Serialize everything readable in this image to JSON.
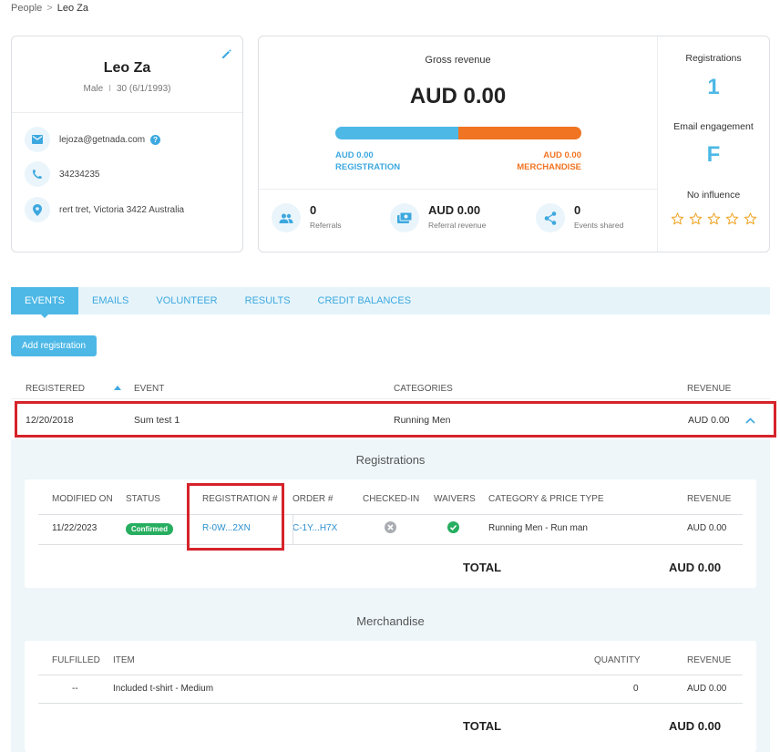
{
  "breadcrumb": {
    "parent": "People",
    "separator": ">",
    "current": "Leo Za"
  },
  "profile": {
    "name": "Leo Za",
    "gender": "Male",
    "divider": "I",
    "age_dob": "30 (6/1/1993)",
    "email": "lejoza@getnada.com",
    "phone": "34234235",
    "address": "rert tret, Victoria 3422 Australia"
  },
  "revenue": {
    "gross_label": "Gross revenue",
    "gross_value": "AUD 0.00",
    "registration_share": 0.5,
    "registration_value": "AUD 0.00",
    "registration_label": "REGISTRATION",
    "merchandise_value": "AUD 0.00",
    "merchandise_label": "MERCHANDISE",
    "colors": {
      "registration": "#4db8e6",
      "merchandise": "#f07422"
    }
  },
  "stats": {
    "referrals_value": "0",
    "referrals_label": "Referrals",
    "referral_revenue_value": "AUD 0.00",
    "referral_revenue_label": "Referral revenue",
    "events_shared_value": "0",
    "events_shared_label": "Events shared"
  },
  "side": {
    "registrations_label": "Registrations",
    "registrations_value": "1",
    "engagement_label": "Email engagement",
    "engagement_value": "F",
    "influence_label": "No influence",
    "influence_stars": 0,
    "influence_max": 5
  },
  "tabs": [
    "EVENTS",
    "EMAILS",
    "VOLUNTEER",
    "RESULTS",
    "CREDIT BALANCES"
  ],
  "add_registration": "Add registration",
  "events_table": {
    "headers": {
      "registered": "REGISTERED",
      "event": "EVENT",
      "categories": "CATEGORIES",
      "revenue": "REVENUE"
    },
    "row": {
      "registered": "12/20/2018",
      "event": "Sum test 1",
      "categories": "Running Men",
      "revenue": "AUD 0.00"
    }
  },
  "registrations": {
    "title": "Registrations",
    "headers": {
      "modified_on": "MODIFIED ON",
      "status": "STATUS",
      "registration_no": "REGISTRATION #",
      "order_no": "ORDER #",
      "checked_in": "CHECKED-IN",
      "waivers": "WAIVERS",
      "category_price": "CATEGORY & PRICE TYPE",
      "revenue": "REVENUE"
    },
    "row": {
      "modified_on": "11/22/2023",
      "status": "Confirmed",
      "registration_no": "R-0W...2XN",
      "order_no": "C-1Y...H7X",
      "category_price": "Running Men - Run man",
      "revenue": "AUD 0.00"
    },
    "total_label": "TOTAL",
    "total_value": "AUD 0.00"
  },
  "merchandise": {
    "title": "Merchandise",
    "headers": {
      "fulfilled": "FULFILLED",
      "item": "ITEM",
      "quantity": "QUANTITY",
      "revenue": "REVENUE"
    },
    "row": {
      "fulfilled": "--",
      "item": "Included t-shirt - Medium",
      "quantity": "0",
      "revenue": "AUD 0.00"
    },
    "total_label": "TOTAL",
    "total_value": "AUD 0.00"
  }
}
